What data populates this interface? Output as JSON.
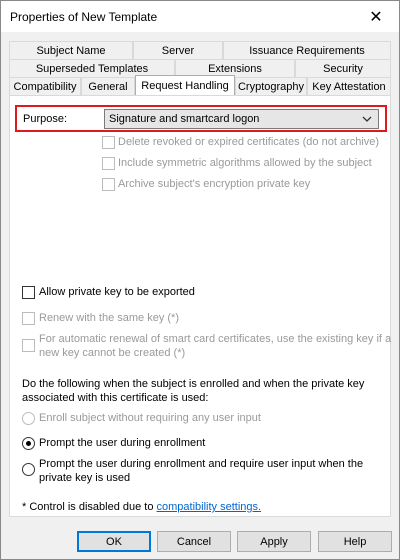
{
  "window": {
    "title": "Properties of New Template",
    "close_symbol": "✕"
  },
  "tabs": {
    "row1": [
      "Subject Name",
      "Server",
      "Issuance Requirements"
    ],
    "row2": [
      "Superseded Templates",
      "Extensions",
      "Security"
    ],
    "row3": [
      "Compatibility",
      "General",
      "Request Handling",
      "Cryptography",
      "Key Attestation"
    ],
    "active": "Request Handling"
  },
  "purpose": {
    "label": "Purpose:",
    "selected": "Signature and smartcard logon"
  },
  "options": {
    "delete_revoked": "Delete revoked or expired certificates (do not archive)",
    "include_symmetric": "Include symmetric algorithms allowed by the subject",
    "archive_key": "Archive subject's encryption private key",
    "allow_export": "Allow private key to be exported",
    "renew_same_key": "Renew with the same key (*)",
    "auto_renewal_line1": "For automatic renewal of smart card certificates, use the existing key if a",
    "auto_renewal_line2": "new key cannot be created (*)"
  },
  "enrollment": {
    "intro_line1": "Do the following when the subject is enrolled and when the private key",
    "intro_line2": "associated with this certificate is used:",
    "opt_no_input": "Enroll subject without requiring any user input",
    "opt_prompt": "Prompt the user during enrollment",
    "opt_prompt_require_line1": "Prompt the user during enrollment and require user input when the",
    "opt_prompt_require_line2": "private key is used",
    "selected": "Prompt the user during enrollment"
  },
  "footnote": {
    "prefix": "* Control is disabled due to ",
    "link": "compatibility settings."
  },
  "buttons": {
    "ok": "OK",
    "cancel": "Cancel",
    "apply": "Apply",
    "help": "Help"
  },
  "colors": {
    "highlight": "#e01a1a",
    "link": "#0066cc",
    "disabled_text": "#9a9a9a"
  }
}
